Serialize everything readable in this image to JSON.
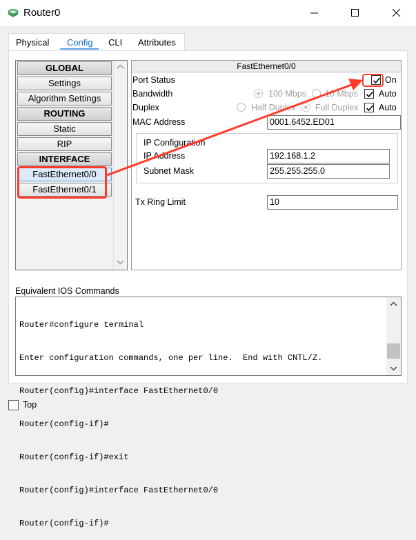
{
  "window": {
    "title": "Router0",
    "icon": "router-icon",
    "controls": [
      "minimize-icon",
      "maximize-icon",
      "close-icon"
    ]
  },
  "tabs": [
    {
      "label": "Physical",
      "active": false
    },
    {
      "label": "Config",
      "active": true
    },
    {
      "label": "CLI",
      "active": false
    },
    {
      "label": "Attributes",
      "active": false
    }
  ],
  "sidebar": {
    "items": [
      {
        "label": "GLOBAL",
        "type": "header"
      },
      {
        "label": "Settings",
        "type": "item"
      },
      {
        "label": "Algorithm Settings",
        "type": "item"
      },
      {
        "label": "ROUTING",
        "type": "header"
      },
      {
        "label": "Static",
        "type": "item"
      },
      {
        "label": "RIP",
        "type": "item"
      },
      {
        "label": "INTERFACE",
        "type": "header"
      },
      {
        "label": "FastEthernet0/0",
        "type": "item",
        "selected": true
      },
      {
        "label": "FastEthernet0/1",
        "type": "item"
      }
    ]
  },
  "interface": {
    "title": "FastEthernet0/0",
    "port_status_label": "Port Status",
    "port_status_on": "On",
    "port_status_checked": true,
    "bandwidth_label": "Bandwidth",
    "bandwidth_100": "100 Mbps",
    "bandwidth_10": "10 Mbps",
    "bandwidth_auto": "Auto",
    "bandwidth_auto_checked": true,
    "duplex_label": "Duplex",
    "duplex_half": "Half Duplex",
    "duplex_full": "Full Duplex",
    "duplex_auto": "Auto",
    "duplex_auto_checked": true,
    "mac_label": "MAC Address",
    "mac_value": "0001.6452.ED01",
    "ip_config_label": "IP Configuration",
    "ip_label": "IP Address",
    "ip_value": "192.168.1.2",
    "mask_label": "Subnet Mask",
    "mask_value": "255.255.255.0",
    "tx_ring_label": "Tx Ring Limit",
    "tx_ring_value": "10"
  },
  "ios": {
    "label": "Equivalent IOS Commands",
    "lines": [
      "Router#configure terminal",
      "Enter configuration commands, one per line.  End with CNTL/Z.",
      "Router(config)#interface FastEthernet0/0",
      "Router(config-if)#",
      "Router(config-if)#exit",
      "Router(config)#interface FastEthernet0/0",
      "Router(config-if)#"
    ]
  },
  "footer": {
    "top_label": "Top",
    "top_checked": false
  },
  "colors": {
    "annotation_red": "#ff3a2a",
    "tab_active_blue": "#0f6fc6"
  }
}
